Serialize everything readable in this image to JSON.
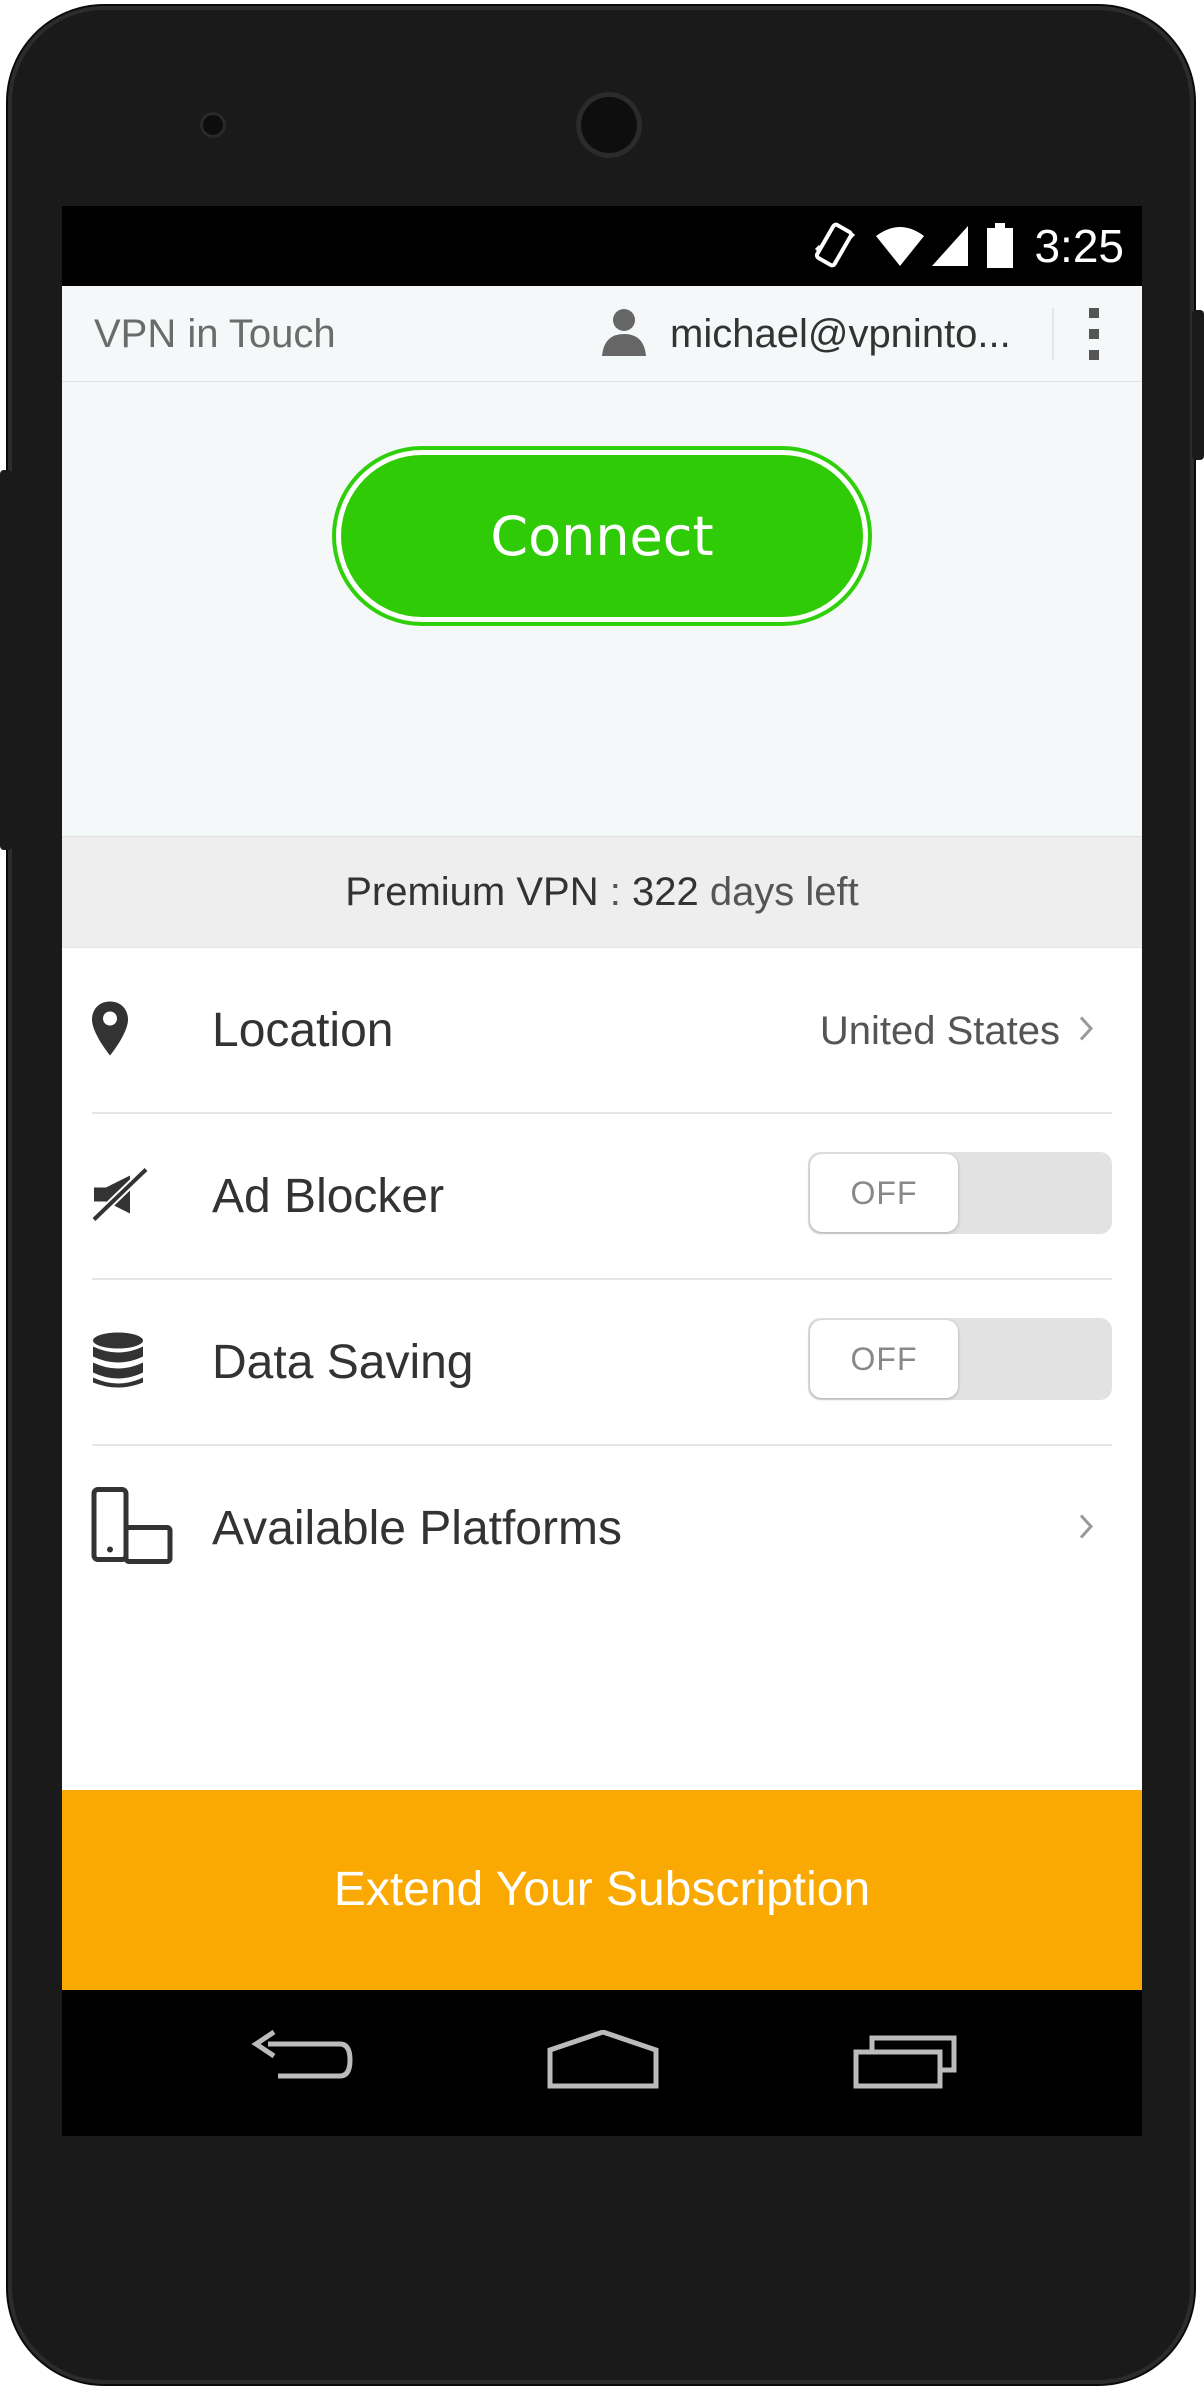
{
  "status_bar": {
    "time": "3:25",
    "icons": [
      "vibrate-icon",
      "wifi-icon",
      "cell-signal-icon",
      "battery-icon"
    ]
  },
  "app_bar": {
    "title": "VPN in Touch",
    "user_email": "michael@vpninto...",
    "icons": [
      "user-icon",
      "overflow-menu-icon"
    ]
  },
  "connect": {
    "label": "Connect",
    "color": "#2fcb06"
  },
  "subscription": {
    "plan": "Premium VPN",
    "separator": " : ",
    "days": "322",
    "suffix": " days left"
  },
  "settings": {
    "location": {
      "label": "Location",
      "value": "United States",
      "icon": "map-pin-icon"
    },
    "ad_blocker": {
      "label": "Ad Blocker",
      "toggle": "OFF",
      "icon": "ad-blocker-icon"
    },
    "data_saving": {
      "label": "Data Saving",
      "toggle": "OFF",
      "icon": "database-icon"
    },
    "platforms": {
      "label": "Available Platforms",
      "icon": "devices-icon"
    }
  },
  "extend": {
    "label": "Extend Your Subscription",
    "color": "#f9a902"
  },
  "nav_bar": {
    "icons": [
      "back-icon",
      "home-icon",
      "recents-icon"
    ]
  }
}
